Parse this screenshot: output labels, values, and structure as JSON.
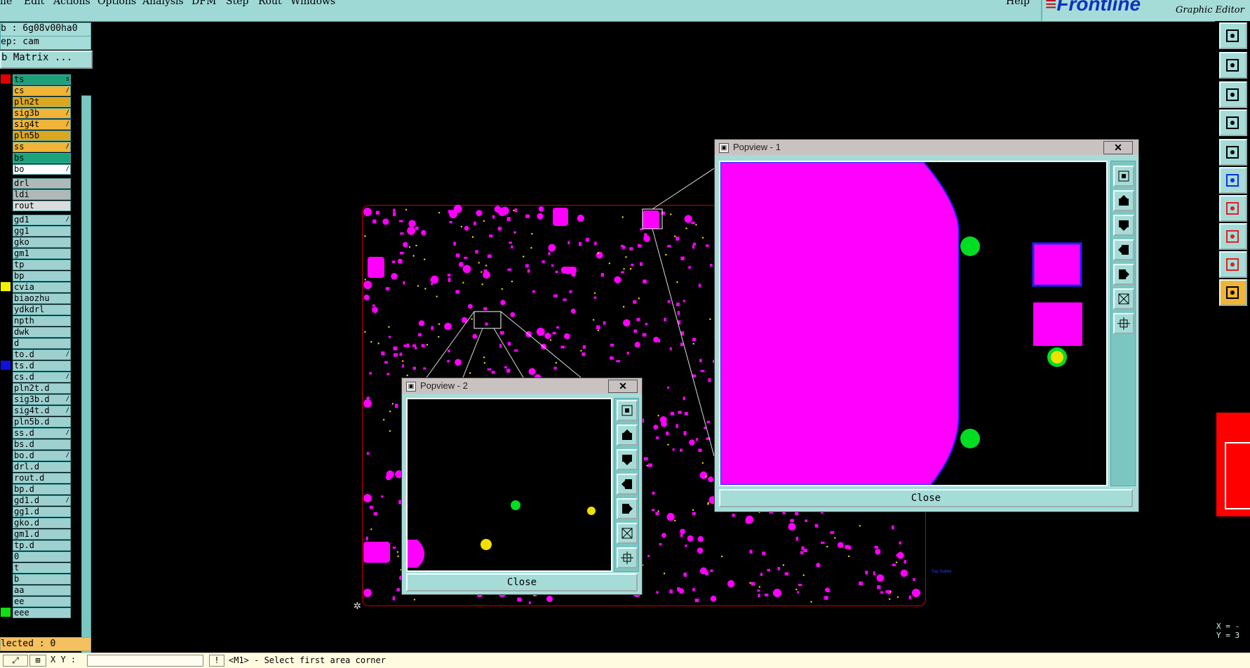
{
  "menu": {
    "items": [
      "ile",
      "Edit",
      "Actions",
      "Options",
      "Analysis",
      "DFM",
      "Step",
      "Rout",
      "Windows"
    ],
    "help": "Help"
  },
  "brand": {
    "logo": "Frontline",
    "subtitle": "Graphic Editor"
  },
  "job": {
    "job_line": "b : 6g08v00ha0",
    "step_line": "ep: cam",
    "matrix_button": "b Matrix ..."
  },
  "layers": [
    {
      "name": "ts",
      "swatch": "#e00000",
      "bg": "#1aa37a",
      "mark": "s"
    },
    {
      "name": "cs",
      "swatch": "",
      "bg": "#f0b437",
      "mark": "/"
    },
    {
      "name": "pln2t",
      "swatch": "",
      "bg": "#d9a720",
      "mark": ""
    },
    {
      "name": "sig3b",
      "swatch": "",
      "bg": "#f0b437",
      "mark": "/"
    },
    {
      "name": "sig4t",
      "swatch": "",
      "bg": "#f0b437",
      "mark": "/"
    },
    {
      "name": "pln5b",
      "swatch": "",
      "bg": "#d9a720",
      "mark": ""
    },
    {
      "name": "ss",
      "swatch": "",
      "bg": "#f0b437",
      "mark": "/"
    },
    {
      "name": "bs",
      "swatch": "",
      "bg": "#1aa37a",
      "mark": ""
    },
    {
      "name": "bo",
      "swatch": "",
      "bg": "#ffffff",
      "mark": "/"
    },
    {
      "name": "drl",
      "swatch": "",
      "bg": "#b0b8b8",
      "mark": ""
    },
    {
      "name": "ldi",
      "swatch": "",
      "bg": "#b0b8b8",
      "mark": ""
    },
    {
      "name": "rout",
      "swatch": "",
      "bg": "#dcdcdc",
      "mark": ""
    },
    {
      "name": "gd1",
      "swatch": "",
      "bg": "#9fd0d0",
      "mark": "/"
    },
    {
      "name": "gg1",
      "swatch": "",
      "bg": "#9fd0d0",
      "mark": ""
    },
    {
      "name": "gko",
      "swatch": "",
      "bg": "#9fd0d0",
      "mark": ""
    },
    {
      "name": "gm1",
      "swatch": "",
      "bg": "#9fd0d0",
      "mark": ""
    },
    {
      "name": "tp",
      "swatch": "",
      "bg": "#9fd0d0",
      "mark": ""
    },
    {
      "name": "bp",
      "swatch": "",
      "bg": "#9fd0d0",
      "mark": ""
    },
    {
      "name": "cvia",
      "swatch": "#f4f000",
      "bg": "#9fd0d0",
      "mark": ""
    },
    {
      "name": "biaozhu",
      "swatch": "",
      "bg": "#9fd0d0",
      "mark": ""
    },
    {
      "name": "ydkdrl",
      "swatch": "",
      "bg": "#9fd0d0",
      "mark": ""
    },
    {
      "name": "npth",
      "swatch": "",
      "bg": "#9fd0d0",
      "mark": ""
    },
    {
      "name": "dwk",
      "swatch": "",
      "bg": "#9fd0d0",
      "mark": ""
    },
    {
      "name": "d",
      "swatch": "",
      "bg": "#9fd0d0",
      "mark": ""
    },
    {
      "name": "to.d",
      "swatch": "",
      "bg": "#9fd0d0",
      "mark": "/"
    },
    {
      "name": "ts.d",
      "swatch": "#1010e0",
      "bg": "#9fd0d0",
      "mark": ""
    },
    {
      "name": "cs.d",
      "swatch": "",
      "bg": "#9fd0d0",
      "mark": "/"
    },
    {
      "name": "pln2t.d",
      "swatch": "",
      "bg": "#9fd0d0",
      "mark": ""
    },
    {
      "name": "sig3b.d",
      "swatch": "",
      "bg": "#9fd0d0",
      "mark": "/"
    },
    {
      "name": "sig4t.d",
      "swatch": "",
      "bg": "#9fd0d0",
      "mark": "/"
    },
    {
      "name": "pln5b.d",
      "swatch": "",
      "bg": "#9fd0d0",
      "mark": ""
    },
    {
      "name": "ss.d",
      "swatch": "",
      "bg": "#9fd0d0",
      "mark": "/"
    },
    {
      "name": "bs.d",
      "swatch": "",
      "bg": "#9fd0d0",
      "mark": ""
    },
    {
      "name": "bo.d",
      "swatch": "",
      "bg": "#9fd0d0",
      "mark": "/"
    },
    {
      "name": "drl.d",
      "swatch": "",
      "bg": "#9fd0d0",
      "mark": ""
    },
    {
      "name": "rout.d",
      "swatch": "",
      "bg": "#9fd0d0",
      "mark": ""
    },
    {
      "name": "bp.d",
      "swatch": "",
      "bg": "#9fd0d0",
      "mark": ""
    },
    {
      "name": "gd1.d",
      "swatch": "",
      "bg": "#9fd0d0",
      "mark": "/"
    },
    {
      "name": "gg1.d",
      "swatch": "",
      "bg": "#9fd0d0",
      "mark": ""
    },
    {
      "name": "gko.d",
      "swatch": "",
      "bg": "#9fd0d0",
      "mark": ""
    },
    {
      "name": "gm1.d",
      "swatch": "",
      "bg": "#9fd0d0",
      "mark": ""
    },
    {
      "name": "tp.d",
      "swatch": "",
      "bg": "#9fd0d0",
      "mark": ""
    },
    {
      "name": "0",
      "swatch": "",
      "bg": "#9fd0d0",
      "mark": ""
    },
    {
      "name": "t",
      "swatch": "",
      "bg": "#9fd0d0",
      "mark": ""
    },
    {
      "name": "b",
      "swatch": "",
      "bg": "#9fd0d0",
      "mark": ""
    },
    {
      "name": "aa",
      "swatch": "",
      "bg": "#9fd0d0",
      "mark": ""
    },
    {
      "name": "ee",
      "swatch": "",
      "bg": "#9fd0d0",
      "mark": ""
    },
    {
      "name": "eee",
      "swatch": "#10e010",
      "bg": "#9fd0d0",
      "mark": ""
    }
  ],
  "status": {
    "selected": "lected : 0",
    "xy_label": "X Y :",
    "xy_value": "",
    "message": "<M1> - Select first area corner",
    "coord_x": "X = -",
    "coord_y": "Y = 3"
  },
  "popview1": {
    "title": "Popview - 1",
    "close_label": "Close"
  },
  "popview2": {
    "title": "Popview - 2",
    "close_label": "Close"
  },
  "canvas_label": "Top Solder",
  "colors": {
    "copper": "#ff00ff",
    "via": "#00dd22",
    "yellow": "#f0e000",
    "outline": "#cc0000",
    "accent": "#a6dcd8"
  },
  "right_tools": [
    "zoom-home-icon",
    "zoom-back-icon",
    "fit-screen-icon",
    "measure-icon",
    "snap-icon",
    "net-icon",
    "line-icon",
    "select-feature-icon",
    "draw-icon",
    "pointer-icon"
  ]
}
